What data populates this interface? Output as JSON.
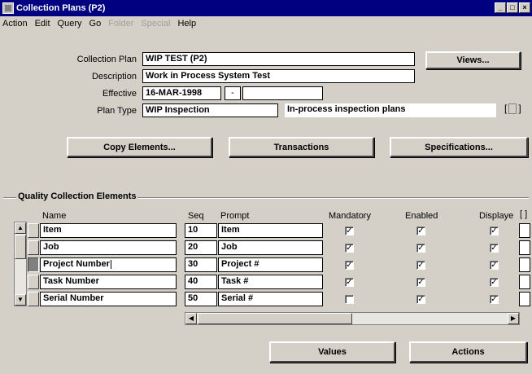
{
  "window": {
    "title": "Collection Plans (P2)"
  },
  "menus": [
    {
      "label": "Action",
      "enabled": true
    },
    {
      "label": "Edit",
      "enabled": true
    },
    {
      "label": "Query",
      "enabled": true
    },
    {
      "label": "Go",
      "enabled": true
    },
    {
      "label": "Folder",
      "enabled": false
    },
    {
      "label": "Special",
      "enabled": false
    },
    {
      "label": "Help",
      "enabled": true
    }
  ],
  "header": {
    "collection_plan_label": "Collection Plan",
    "collection_plan_value": "WIP TEST (P2)",
    "description_label": "Description",
    "description_value": "Work in Process System Test",
    "effective_label": "Effective",
    "effective_from": "16-MAR-1998",
    "effective_sep": "-",
    "effective_to": "",
    "plan_type_label": "Plan Type",
    "plan_type_value": "WIP Inspection",
    "plan_type_desc": "In-process inspection plans",
    "views_button": "Views..."
  },
  "buttons": {
    "copy_elements": "Copy Elements...",
    "transactions": "Transactions",
    "specifications": "Specifications...",
    "values": "Values",
    "actions": "Actions"
  },
  "elements": {
    "section_title": "Quality Collection Elements",
    "columns": {
      "name": "Name",
      "seq": "Seq",
      "prompt": "Prompt",
      "mandatory": "Mandatory",
      "enabled": "Enabled",
      "displayed": "Displaye"
    },
    "rows": [
      {
        "name": "Item",
        "seq": "10",
        "prompt": "Item",
        "mandatory": true,
        "enabled": true,
        "displayed": true
      },
      {
        "name": "Job",
        "seq": "20",
        "prompt": "Job",
        "mandatory": true,
        "enabled": true,
        "displayed": true
      },
      {
        "name": "Project Number",
        "seq": "30",
        "prompt": "Project #",
        "mandatory": true,
        "enabled": true,
        "displayed": true
      },
      {
        "name": "Task Number",
        "seq": "40",
        "prompt": "Task #",
        "mandatory": true,
        "enabled": true,
        "displayed": true
      },
      {
        "name": "Serial Number",
        "seq": "50",
        "prompt": "Serial #",
        "mandatory": false,
        "enabled": true,
        "displayed": true
      }
    ],
    "current_row": 2
  },
  "icons": {
    "window_icon": "app-icon",
    "minimize": "minimize-icon",
    "maximize": "maximize-icon",
    "close": "close-icon",
    "scroll_up": "scroll-up-icon",
    "scroll_down": "scroll-down-icon",
    "scroll_left": "scroll-left-icon",
    "scroll_right": "scroll-right-icon",
    "checkmark": "checkmark-icon"
  },
  "colors": {
    "titlebar": "#000080",
    "face": "#d4d0c8",
    "field": "#ffffff"
  }
}
